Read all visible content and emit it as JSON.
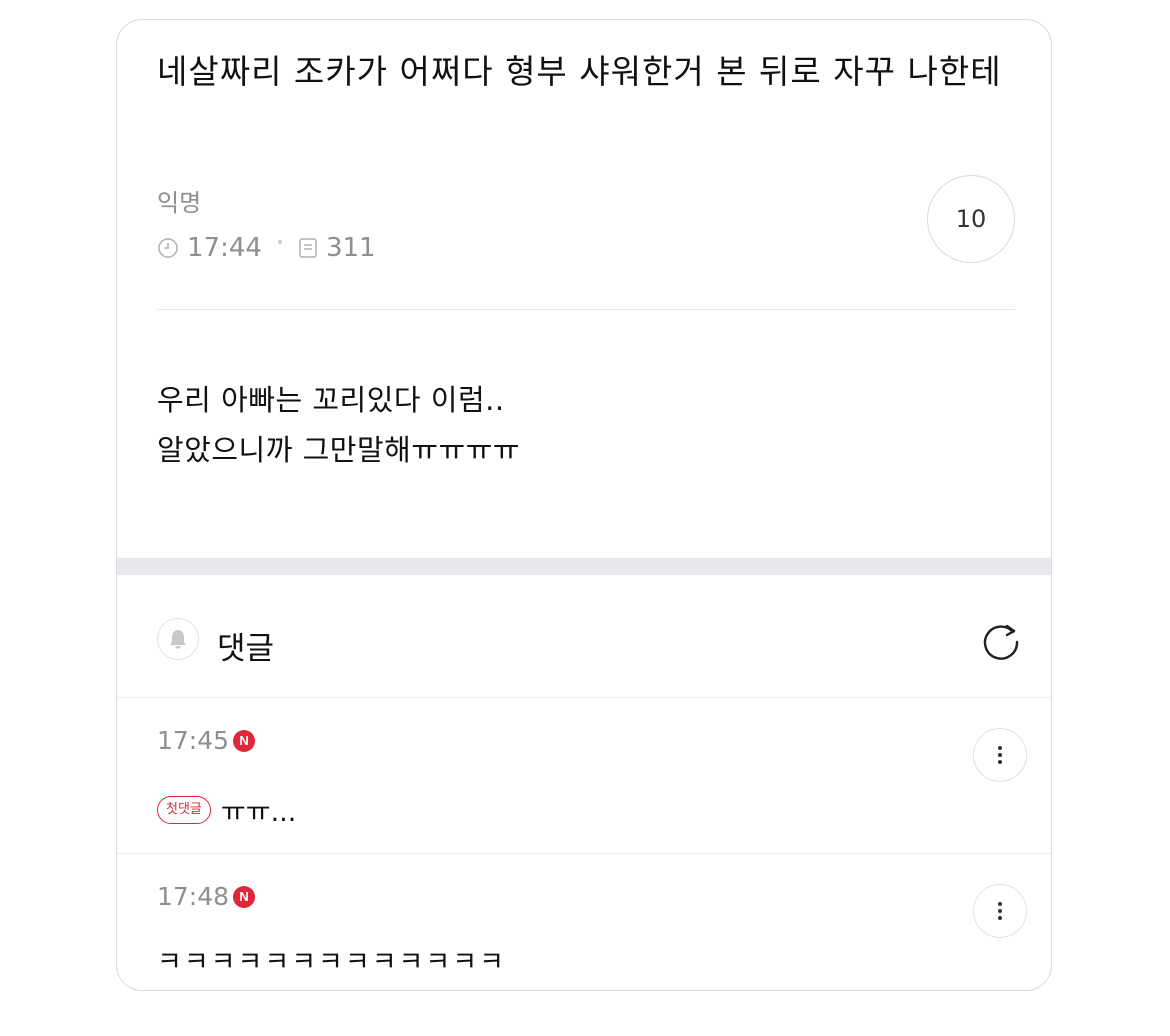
{
  "post": {
    "title": "네살짜리 조카가 어쩌다 형부 샤워한거 본 뒤로 자꾸 나한테",
    "author": "익명",
    "time": "17:44",
    "views": "311",
    "comment_count": "10",
    "body_line1": "우리 아빠는 꼬리있다 이럼..",
    "body_line2": "알았으니까 그만말해ㅠㅠㅠㅠ"
  },
  "comments_section": {
    "title": "댓글"
  },
  "comments": [
    {
      "time": "17:45",
      "new_badge": "N",
      "first_badge": "첫댓글",
      "text": "ㅠㅠ..."
    },
    {
      "time": "17:48",
      "new_badge": "N",
      "text": "ㅋㅋㅋㅋㅋㅋㅋㅋㅋㅋㅋㅋㅋ"
    }
  ],
  "colors": {
    "accent": "#e0263a",
    "muted_text": "#8e8e93",
    "divider": "#e5e5ea",
    "section_gap": "#e8e8ee"
  },
  "icons": [
    "clock-icon",
    "document-icon",
    "bell-icon",
    "refresh-icon",
    "more-vertical-icon"
  ]
}
